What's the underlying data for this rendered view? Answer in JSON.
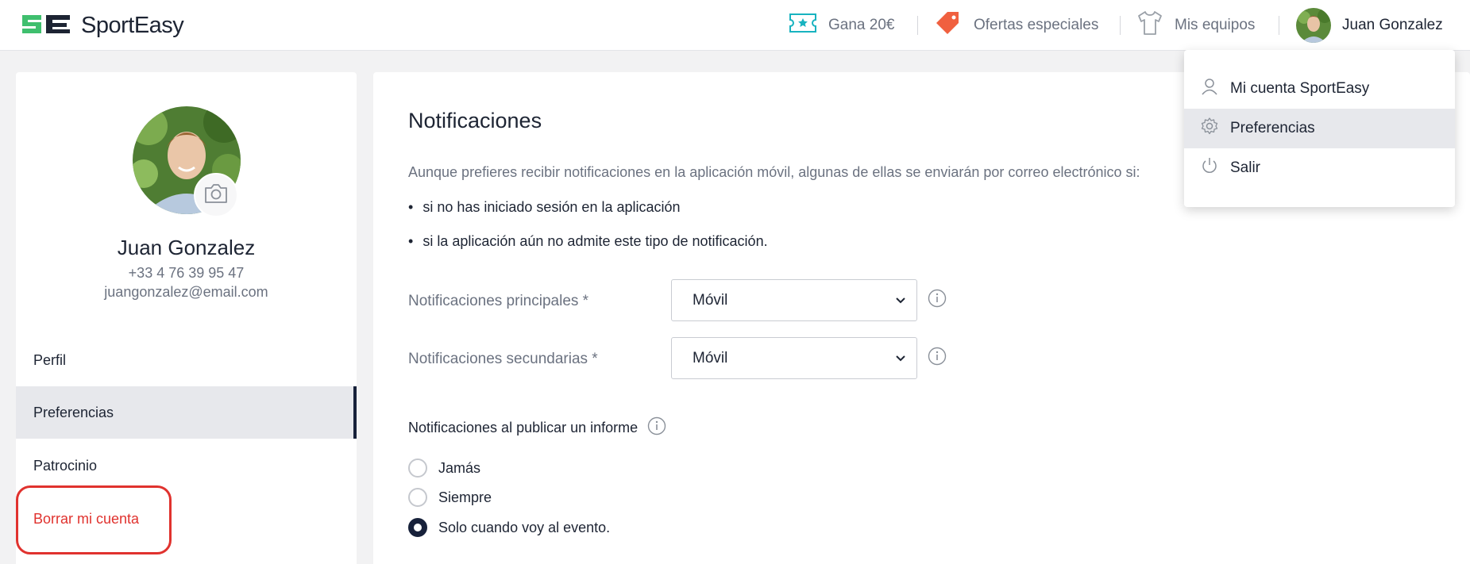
{
  "header": {
    "brand": "SportEasy",
    "nav": {
      "earn": "Gana 20€",
      "offers": "Ofertas especiales",
      "teams": "Mis equipos",
      "user": "Juan Gonzalez"
    },
    "icons": {
      "logo": "sporteasy-logo-icon",
      "earn": "ticket-icon",
      "offers": "tag-icon",
      "teams": "jersey-icon"
    },
    "colors": {
      "logo": "#3fbf6e",
      "ticket": "#18b3c0",
      "tag": "#f0603f"
    }
  },
  "profile": {
    "name": "Juan Gonzalez",
    "phone": "+33 4 76 39 95 47",
    "email": "juangonzalez@email.com"
  },
  "sidebar": {
    "items": [
      {
        "label": "Perfil"
      },
      {
        "label": "Preferencias",
        "active": true
      },
      {
        "label": "Patrocinio"
      },
      {
        "label": "Borrar mi cuenta",
        "danger": true
      }
    ]
  },
  "main": {
    "title": "Notificaciones",
    "intro": "Aunque prefieres recibir notificaciones en la aplicación móvil, algunas de ellas se enviarán por correo electrónico si:",
    "bullets": [
      "si no has iniciado sesión en la aplicación",
      "si la aplicación aún no admite este tipo de notificación."
    ],
    "fields": {
      "primary": {
        "label": "Notificaciones principales *",
        "value": "Móvil"
      },
      "secondary": {
        "label": "Notificaciones secundarias *",
        "value": "Móvil"
      }
    },
    "report": {
      "title": "Notificaciones al publicar un informe",
      "options": [
        "Jamás",
        "Siempre",
        "Solo cuando voy al evento."
      ],
      "selected": 2
    }
  },
  "dropdown": {
    "items": [
      {
        "label": "Mi cuenta SportEasy",
        "icon": "user-icon"
      },
      {
        "label": "Preferencias",
        "icon": "gear-icon",
        "hover": true
      },
      {
        "label": "Salir",
        "icon": "power-icon"
      }
    ]
  }
}
